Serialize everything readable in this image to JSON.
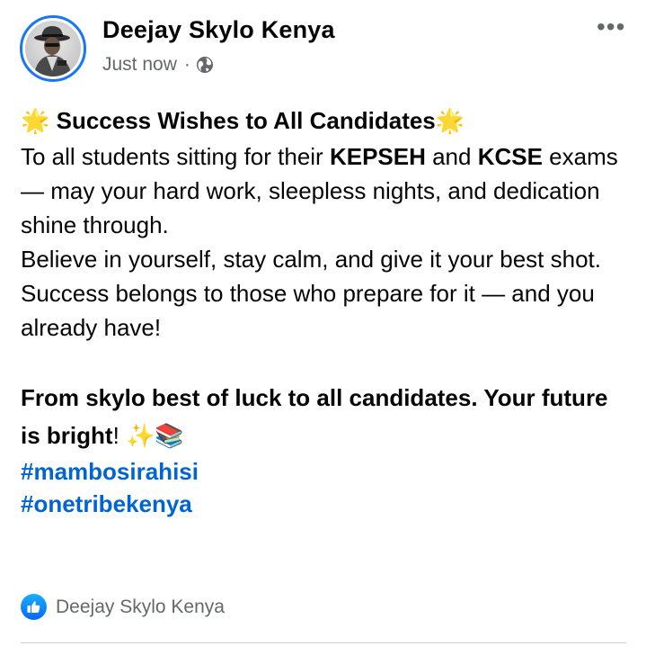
{
  "header": {
    "page_name": "Deejay Skylo Kenya",
    "timestamp": "Just now",
    "separator": "·",
    "audience_icon": "globe-icon",
    "more_label": "•••"
  },
  "post": {
    "title_emoji_left": "🌟",
    "title": "Success Wishes to All Candidates",
    "title_emoji_right": "🌟",
    "line1_a": "To all students sitting for their ",
    "line1_b": "KEPSEH",
    "line1_c": " and ",
    "line1_d": "KCSE",
    "line1_e": " exams — may your hard work, sleepless nights, and dedication shine through.",
    "line2": "Believe in yourself, stay calm, and give it your best shot.",
    "line3": "Success belongs to those who prepare for it — and you already have!",
    "closing_a": "From skylo best of luck to all candidates",
    "closing_b": ". ",
    "closing_c": "Your future is bright",
    "closing_d": "! ",
    "closing_emoji": "✨📚",
    "hashtags": [
      "#mambosirahisi",
      "#onetribekenya"
    ]
  },
  "reactions": {
    "icon": "like-icon",
    "label": "Deejay Skylo Kenya"
  },
  "colors": {
    "accent": "#1877f2",
    "hashtag": "#0064d1",
    "secondary_text": "#65676b"
  }
}
